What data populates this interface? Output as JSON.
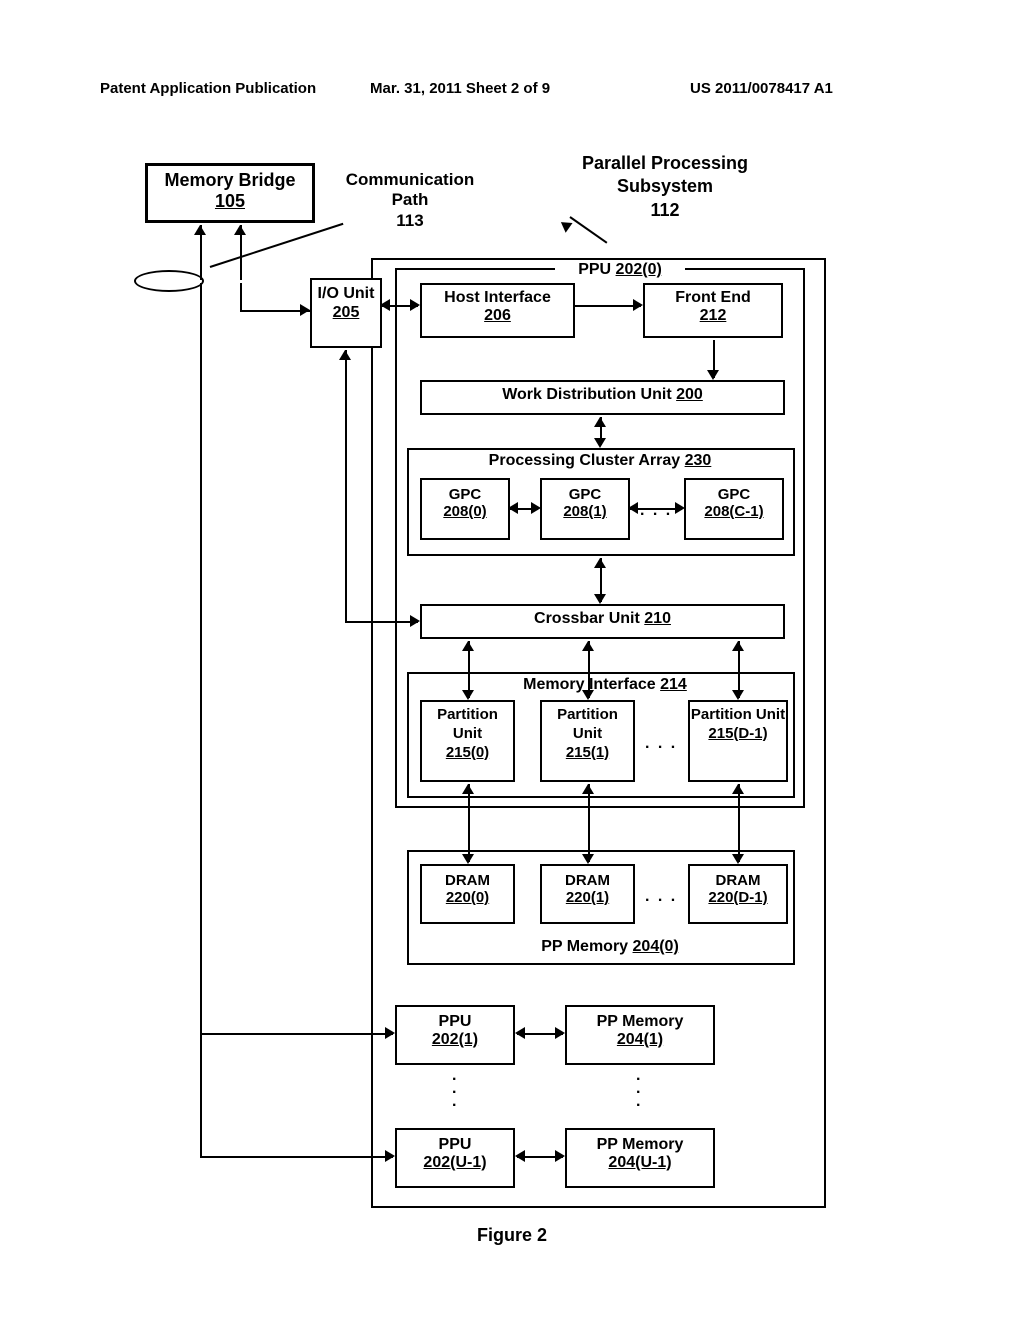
{
  "header": {
    "left": "Patent Application Publication",
    "mid": "Mar. 31, 2011  Sheet 2 of 9",
    "right": "US 2011/0078417 A1"
  },
  "labels": {
    "mem_bridge_title": "Memory Bridge",
    "mem_bridge_num": "105",
    "comm_path_title": "Communication Path",
    "comm_path_num": "113",
    "pps_title": "Parallel Processing Subsystem",
    "pps_num": "112",
    "ppu0_title": "PPU",
    "ppu0_num": "202(0)",
    "io_title": "I/O Unit",
    "io_num": "205",
    "hostif_title": "Host Interface",
    "hostif_num": "206",
    "frontend_title": "Front End",
    "frontend_num": "212",
    "wdu_title": "Work Distribution Unit",
    "wdu_num": "200",
    "pca_title": "Processing Cluster Array",
    "pca_num": "230",
    "gpc_title": "GPC",
    "gpc0": "208(0)",
    "gpc1": "208(1)",
    "gpcN": "208(C-1)",
    "xbar_title": "Crossbar Unit",
    "xbar_num": "210",
    "memif_title": "Memory Interface",
    "memif_num": "214",
    "part_title": "Partition Unit",
    "part0": "215(0)",
    "part1": "215(1)",
    "partN": "215(D-1)",
    "dram_title": "DRAM",
    "dram0": "220(0)",
    "dram1": "220(1)",
    "dramN": "220(D-1)",
    "ppmem0_title": "PP Memory",
    "ppmem0_num": "204(0)",
    "ppu1_title": "PPU",
    "ppu1_num": "202(1)",
    "ppmem1_title": "PP Memory",
    "ppmem1_num": "204(1)",
    "ppuN_title": "PPU",
    "ppuN_num": "202(U-1)",
    "ppmemN_title": "PP Memory",
    "ppmemN_num": "204(U-1)",
    "dots3": ". . .",
    "vdots": ".",
    "figure": "Figure 2"
  }
}
